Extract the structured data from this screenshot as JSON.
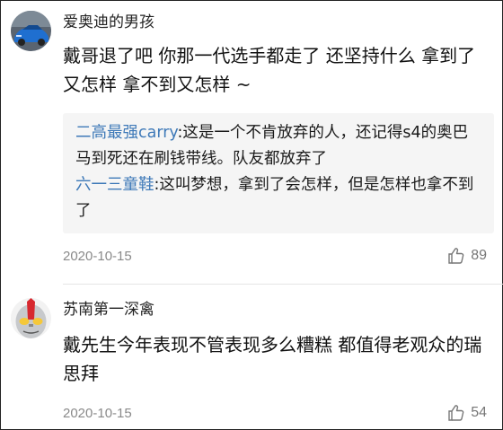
{
  "comments": [
    {
      "username": "爱奥迪的男孩",
      "text": "戴哥退了吧 你那一代选手都走了 还坚持什么 拿到了又怎样 拿不到又怎样 ~",
      "replies": [
        {
          "name": "二高最强carry",
          "text": ":这是一个不肯放弃的人，还记得s4的奥巴马到死还在刷钱带线。队友都放弃了"
        },
        {
          "name": "六一三童鞋",
          "text": ":这叫梦想，拿到了会怎样，但是怎样也拿不到了"
        }
      ],
      "date": "2020-10-15",
      "likes": "89",
      "avatar_icon": "blue-car-avatar"
    },
    {
      "username": "苏南第一深禽",
      "text": "戴先生今年表现不管表现多么糟糕 都值得老观众的瑞思拜",
      "date": "2020-10-15",
      "likes": "54",
      "avatar_icon": "ultraman-avatar"
    }
  ],
  "colors": {
    "reply_name": "#3e79b8",
    "reply_bg": "#f5f5f5",
    "date": "#8a8a8a"
  }
}
